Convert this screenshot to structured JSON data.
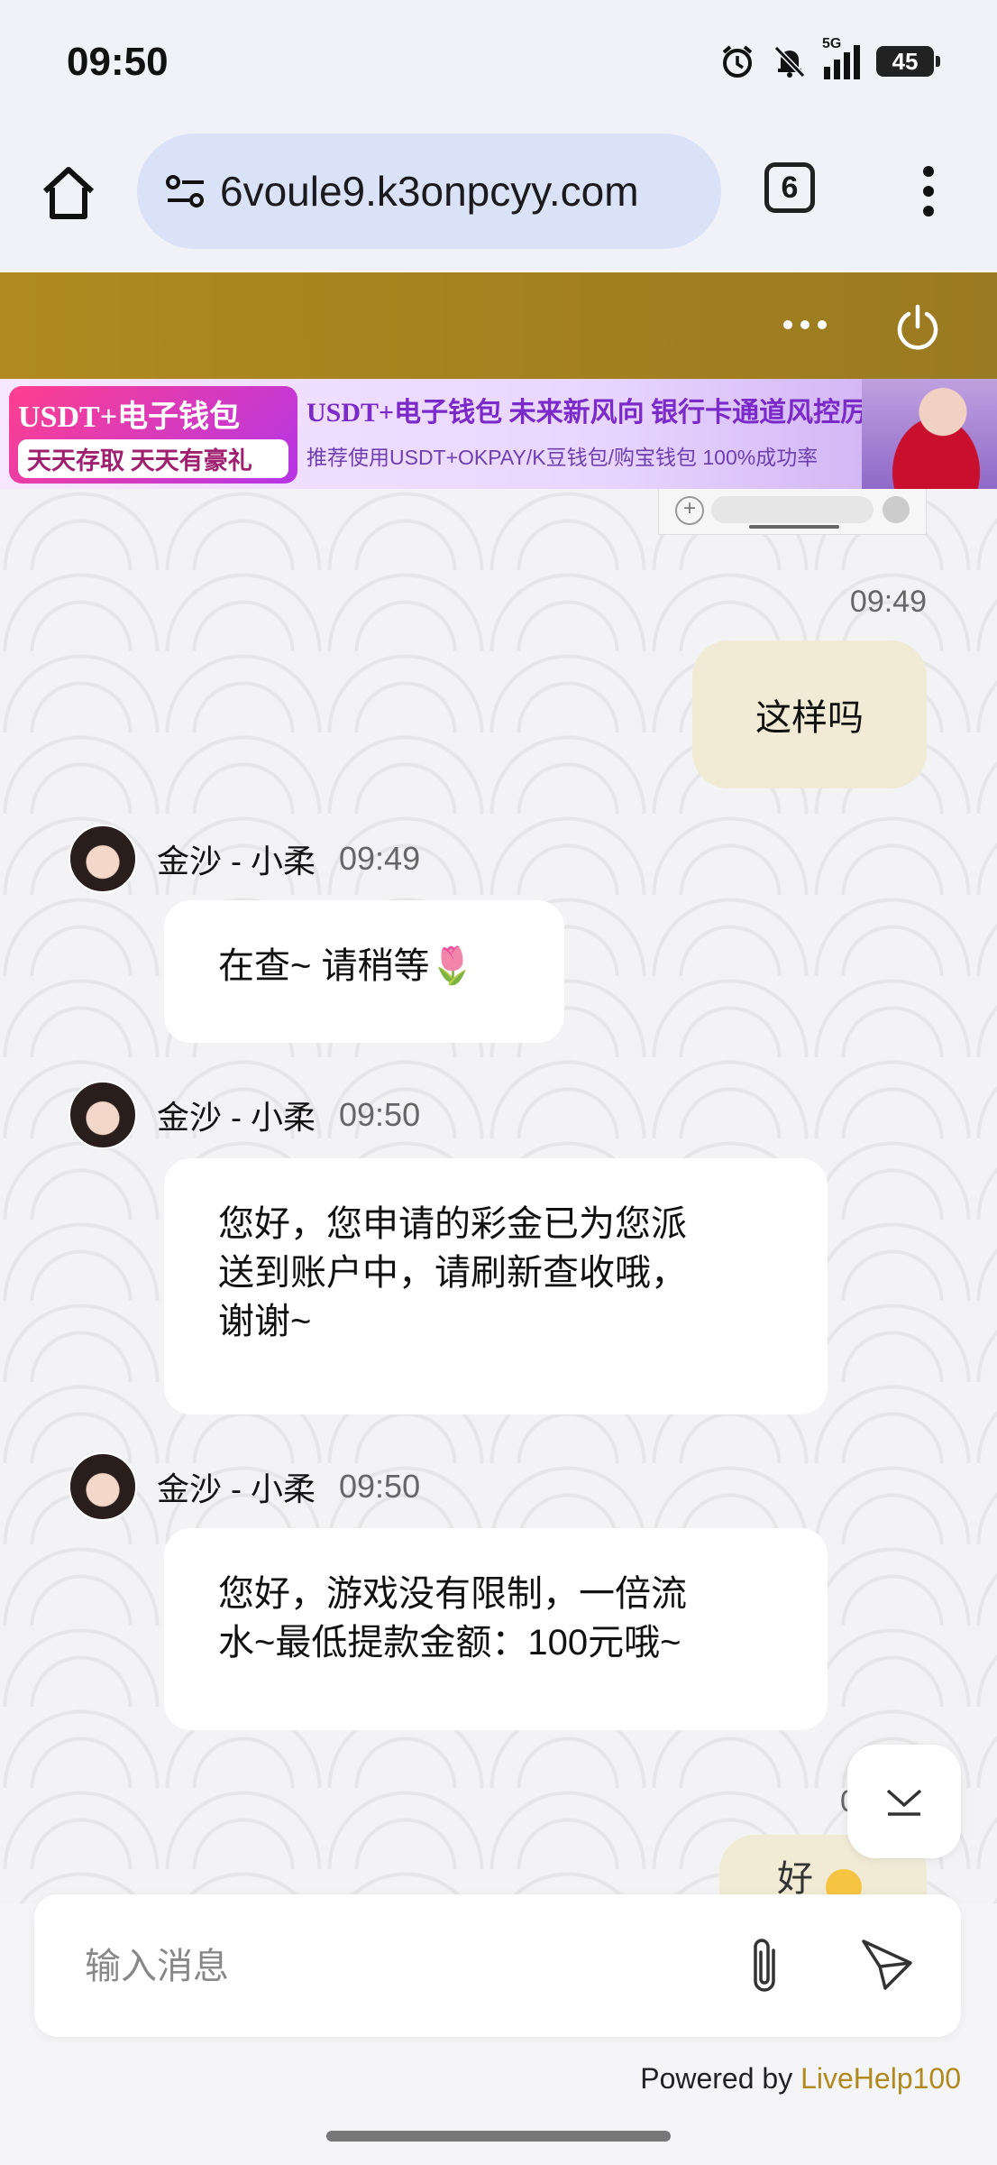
{
  "status_bar": {
    "time": "09:50",
    "network": "5G",
    "battery": "45",
    "icons": [
      "alarm-icon",
      "mute-bell-icon",
      "signal-icon",
      "battery-icon"
    ]
  },
  "browser": {
    "url": "6voule9.k3onpcyy.com",
    "tab_count": "6"
  },
  "banner": {
    "left_line1": "USDT+电子钱包",
    "left_line2": "天天存取 天天有豪礼",
    "headline": "USDT+电子钱包   未来新风向   银行卡通道风控厉害",
    "subline": "推荐使用USDT+OKPAY/K豆钱包/购宝钱包   100%成功率"
  },
  "chat": {
    "outgoing": [
      {
        "time": "09:49",
        "text": "这样吗"
      }
    ],
    "messages": [
      {
        "sender": "金沙 - 小柔",
        "time": "09:49",
        "text": "在查~ 请稍等🌷"
      },
      {
        "sender": "金沙 - 小柔",
        "time": "09:50",
        "lines": [
          "您好，您申请的彩金已为您派",
          "送到账户中，请刷新查收哦，",
          "谢谢~"
        ]
      },
      {
        "sender": "金沙 - 小柔",
        "time": "09:50",
        "lines": [
          "您好，游戏没有限制，一倍流",
          "水~最低提款金额：100元哦~"
        ]
      }
    ],
    "peek_char": "好",
    "peek_time_fragment": "0"
  },
  "input": {
    "placeholder": "输入消息"
  },
  "footer": {
    "powered_prefix": "Powered by ",
    "brand": "LiveHelp100"
  },
  "colors": {
    "header_gold": "#a3801f",
    "brand_gold": "#b08a20",
    "outgoing_bubble": "#f1ead5",
    "incoming_bubble": "#ffffff"
  }
}
